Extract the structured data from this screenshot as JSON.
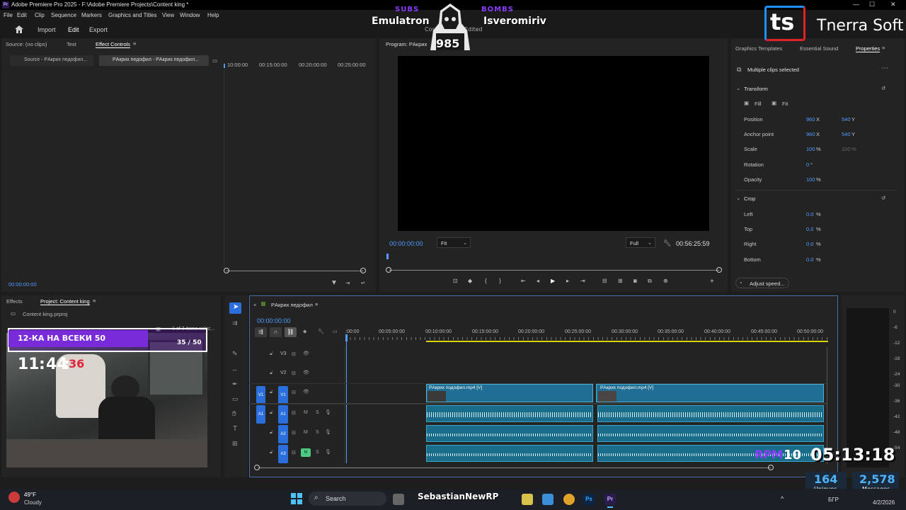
{
  "window": {
    "title": "Adobe Premiere Pro 2025 - F:\\Adobe Premiere Projects\\Content king *",
    "app_badge": "Pr",
    "minimize": "—",
    "maximize": "☐",
    "close": "✕"
  },
  "menu": [
    "File",
    "Edit",
    "Clip",
    "Sequence",
    "Markers",
    "Graphics and Titles",
    "View",
    "Window",
    "Help"
  ],
  "modes": {
    "home_icon": "home-icon",
    "import": "Import",
    "edit": "Edit",
    "export": "Export"
  },
  "source_panel": {
    "tabs": [
      "Source: (no clips)",
      "Text",
      "Effect Controls"
    ],
    "clip_tabs": [
      "Source - PАкрих педофил...",
      "PАкрих педофил - PАкрих педофил..."
    ],
    "ruler": [
      "10:00:00",
      "00:15:00:00",
      "00:20:00:00",
      "00:25:00:00"
    ],
    "timecode": "00:00:00:00"
  },
  "program": {
    "title": "Program: PАкрих",
    "timecode": "00:00:00:00",
    "fit": "Fit",
    "quality": "Full",
    "duration": "00:56:25:59"
  },
  "properties": {
    "tabs": [
      "Graphics Templates",
      "Essential Sound",
      "Properties"
    ],
    "header": "Multiple clips selected",
    "transform": "Transform",
    "fill": "Fill",
    "fit": "Fit",
    "position": {
      "label": "Position",
      "x": "960",
      "y": "540"
    },
    "anchor": {
      "label": "Anchor point",
      "x": "960",
      "y": "540"
    },
    "scale": {
      "label": "Scale",
      "v1": "100",
      "v2": "100"
    },
    "rotation": {
      "label": "Rotation",
      "v": "0"
    },
    "opacity": {
      "label": "Opacity",
      "v": "100"
    },
    "crop": "Crop",
    "crop_rows": [
      {
        "label": "Left",
        "v": "0.0"
      },
      {
        "label": "Top",
        "v": "0.0"
      },
      {
        "label": "Right",
        "v": "0.0"
      },
      {
        "label": "Bottom",
        "v": "0.0"
      }
    ],
    "adjust": "Adjust speed...",
    "x": "X",
    "y": "Y",
    "pct": "%",
    "deg": "°"
  },
  "project": {
    "tabs": [
      "Effects",
      "Project: Content king"
    ],
    "file": "Content king.prproj",
    "selected": "1 of 3 items selec..."
  },
  "timeline": {
    "seq_name": "PАкрих педофил",
    "timecode": "00:00:00:00",
    "ruler": [
      ":00:00",
      "00:05:00:00",
      "00:10:00:00",
      "00:15:00:00",
      "00:20:00:00",
      "00:25:00:00",
      "00:30:00:00",
      "00:35:00:00",
      "00:40:00:00",
      "00:45:00:00",
      "00:50:00:00"
    ],
    "tracks": [
      {
        "id": "V3",
        "src": ""
      },
      {
        "id": "V2",
        "src": ""
      },
      {
        "id": "V1",
        "src": "V1"
      },
      {
        "id": "A1",
        "src": "A1",
        "m": "M",
        "s": "S"
      },
      {
        "id": "A2",
        "src": "",
        "m": "M",
        "s": "S"
      },
      {
        "id": "A3",
        "src": "",
        "m": "M",
        "s": "S"
      }
    ],
    "clip1": "PАкрих подофил.mp4 [V]",
    "clip2": "PАкрих подофил.mp4 [V]"
  },
  "meter": [
    "0",
    "-6",
    "-12",
    "-18",
    "-24",
    "-30",
    "-36",
    "-42",
    "-48",
    "-54"
  ],
  "overlay": {
    "subs_label": "SUBS",
    "bombs_label": "BOMBS",
    "subs_name": "Emulatron",
    "bombs_name": "Isveromiriv",
    "goal": "985",
    "cost": "Cost",
    "edited": "Edited",
    "ts_logo": "ts",
    "ts_text": "Tnerra Soft",
    "banner": "12-КА НА ВСЕКИ 50",
    "banner_count": "35 / 50",
    "clock_h": "11",
    "clock_m": "44",
    "clock_s": "36",
    "rpm": "RPM",
    "rpm_val": "10",
    "timer": "05:13:18",
    "uniques_val": "164",
    "uniques_label": "Uniques",
    "messages_val": "2,578",
    "messages_label": "Messages",
    "streamer": "SebastianNewRP"
  },
  "taskbar": {
    "temp": "49°F",
    "weather": "Cloudy",
    "search": "Search",
    "lang": "БГР",
    "date": "4/2/2026"
  },
  "colors": {
    "accent": "#4f9bff",
    "video": "#1f6e93",
    "track_active": "#2a6fdb",
    "playhead": "#4f9bff",
    "purple": "#8b3dff"
  }
}
